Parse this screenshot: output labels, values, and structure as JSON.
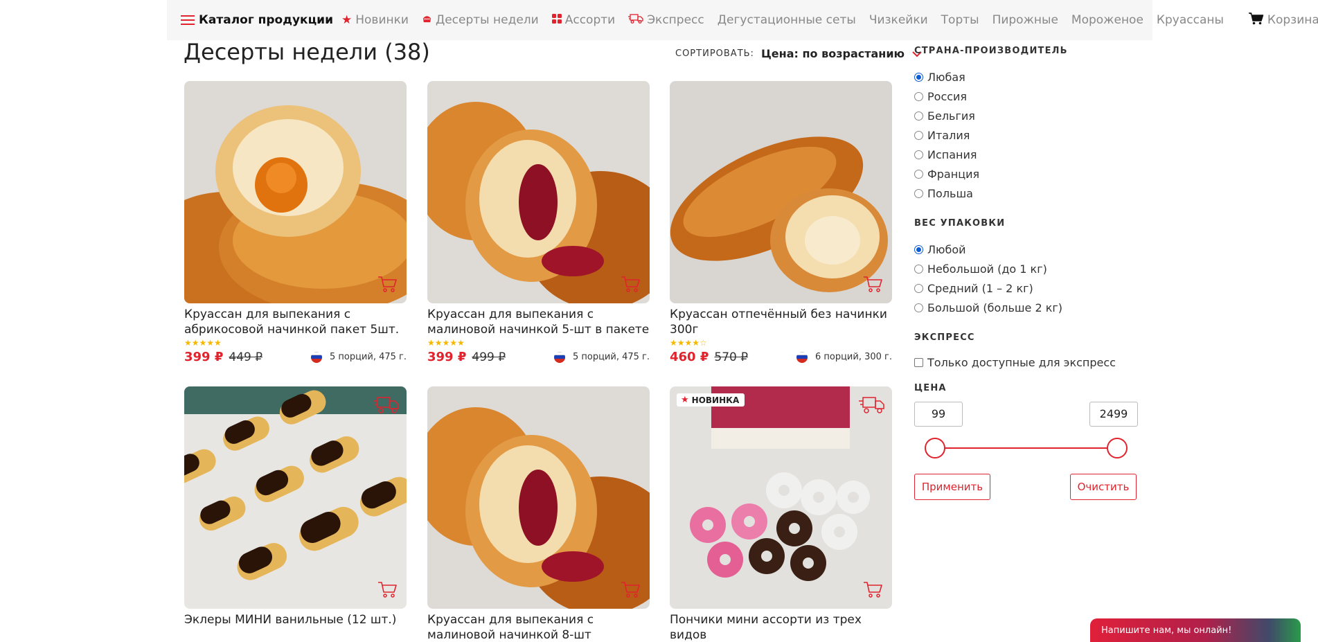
{
  "nav": {
    "catalog": "Каталог продукции",
    "items": [
      {
        "label": "Новинки",
        "icon": "star-icon"
      },
      {
        "label": "Десерты недели",
        "icon": "cake-icon"
      },
      {
        "label": "Ассорти",
        "icon": "grid-icon"
      },
      {
        "label": "Экспресс",
        "icon": "truck-icon"
      },
      {
        "label": "Дегустационные сеты",
        "icon": ""
      },
      {
        "label": "Чизкейки",
        "icon": ""
      },
      {
        "label": "Торты",
        "icon": ""
      },
      {
        "label": "Пирожные",
        "icon": ""
      },
      {
        "label": "Мороженое",
        "icon": ""
      },
      {
        "label": "Круассаны",
        "icon": ""
      }
    ],
    "cart": "Корзина"
  },
  "header": {
    "title": "Десерты недели (38)",
    "sort_label": "СОРТИРОВАТЬ:",
    "sort_value": "Цена: по возрастанию"
  },
  "products": [
    {
      "name": "Круассан для выпекания с абрикосовой начинкой пакет 5шт.",
      "stars": "★★★★★",
      "price": "399 ₽",
      "old_price": "449 ₽",
      "meta": "5 порций, 475 г.",
      "country": "russia"
    },
    {
      "name": "Круассан для выпекания с малиновой начинкой 5-шт в пакете",
      "stars": "★★★★★",
      "price": "399 ₽",
      "old_price": "499 ₽",
      "meta": "5 порций, 475 г.",
      "country": "russia"
    },
    {
      "name": "Круассан отпечённый без начинки 300г",
      "stars": "★★★★☆",
      "price": "460 ₽",
      "old_price": "570 ₽",
      "meta": "6 порций, 300 г.",
      "country": "russia"
    },
    {
      "name": "Эклеры МИНИ ванильные (12 шт.)",
      "stars": "★★★★☆",
      "price": "",
      "old_price": "",
      "meta": "",
      "country": "belgium"
    },
    {
      "name": "Круассан для выпекания с малиновой начинкой 8-шт",
      "stars": "",
      "price": "",
      "old_price": "",
      "meta": "",
      "country": ""
    },
    {
      "name": "Пончики мини ассорти из трех видов",
      "stars": "★★★★☆",
      "price": "",
      "old_price": "",
      "meta": "",
      "country": "belgium",
      "badge": "НОВИНКА"
    }
  ],
  "filters": {
    "country": {
      "title": "СТРАНА-ПРОИЗВОДИТЕЛЬ",
      "options": [
        "Любая",
        "Россия",
        "Бельгия",
        "Италия",
        "Испания",
        "Франция",
        "Польша"
      ],
      "selected": 0
    },
    "weight": {
      "title": "ВЕС УПАКОВКИ",
      "options": [
        "Любой",
        "Небольшой (до 1 кг)",
        "Средний (1 – 2 кг)",
        "Большой (больше 2 кг)"
      ],
      "selected": 0
    },
    "express": {
      "title": "ЭКСПРЕСС",
      "checkbox": "Только доступные для экспресс"
    },
    "price": {
      "title": "ЦЕНА",
      "min": "99",
      "max": "2499",
      "apply": "Применить",
      "clear": "Очистить"
    }
  },
  "chat": "Напишите нам, мы онлайн!",
  "colors": {
    "accent": "#e0232d",
    "star": "#f5b800",
    "radio": "#0a5bd6"
  }
}
